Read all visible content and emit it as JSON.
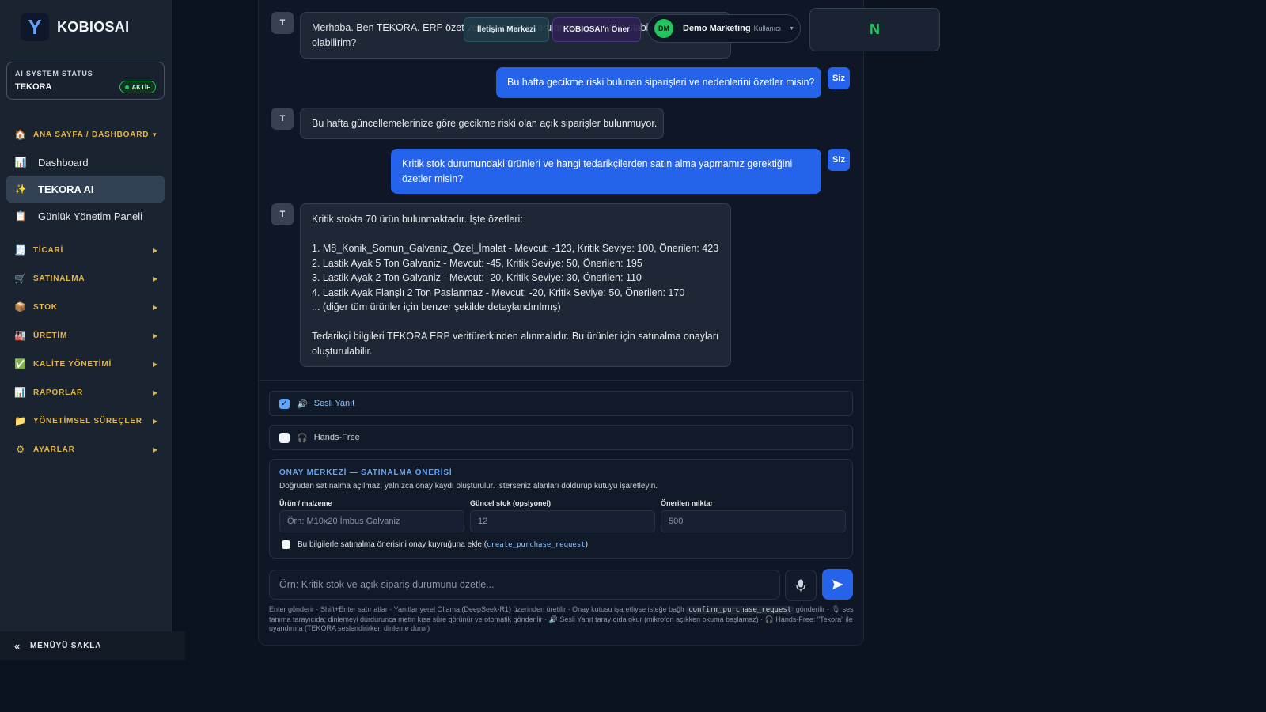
{
  "brand": {
    "logo": "Y",
    "name": "KOBIOSAI"
  },
  "status": {
    "label": "AI SYSTEM STATUS",
    "name": "TEKORA",
    "badge": "AKTİF"
  },
  "nav": {
    "home_section": "ANA SAYFA / DASHBOARD",
    "items": [
      {
        "label": "Dashboard",
        "icon": "chart-icon"
      },
      {
        "label": "TEKORA AI",
        "icon": "sparkle-icon"
      },
      {
        "label": "Günlük Yönetim Paneli",
        "icon": "clipboard-icon"
      }
    ],
    "sections": [
      {
        "label": "TİCARİ",
        "icon": "register-icon"
      },
      {
        "label": "SATINALMA",
        "icon": "cart-icon"
      },
      {
        "label": "STOK",
        "icon": "box-icon"
      },
      {
        "label": "ÜRETİM",
        "icon": "factory-icon"
      },
      {
        "label": "KALİTE YÖNETİMİ",
        "icon": "check-icon"
      },
      {
        "label": "RAPORLAR",
        "icon": "chart-icon"
      },
      {
        "label": "YÖNETİMSEL SÜREÇLER",
        "icon": "folder-icon"
      },
      {
        "label": "AYARLAR",
        "icon": "gear-icon"
      }
    ],
    "collapse_label": "MENÜYÜ SAKLA"
  },
  "header": {
    "btn_comm": "İletişim Merkezi",
    "btn_suggest": "KOBIOSAI'n Öner",
    "user": {
      "initials": "DM",
      "name": "Demo Marketing",
      "role": "Kullanıcı"
    },
    "notif": "N"
  },
  "chat": {
    "bot_avatar": "T",
    "user_badge": "Siz",
    "messages": [
      {
        "role": "bot",
        "lines": [
          "Merhaba. Ben TEKORA. ERP özet verilerine göre sorularınıza yardımcı olabilirim. Nasıl yardımcı",
          "olabilirim?"
        ]
      },
      {
        "role": "user",
        "lines": [
          "Bu hafta gecikme riski bulunan siparişleri ve nedenlerini özetler misin?"
        ]
      },
      {
        "role": "bot",
        "lines": [
          "Bu hafta güncellemelerinize göre gecikme riski olan açık siparişler bulunmuyor."
        ]
      },
      {
        "role": "user",
        "lines": [
          "Kritik stok durumundaki ürünleri ve hangi tedarikçilerden satın alma yapmamız gerektiğini",
          "özetler misin?"
        ]
      },
      {
        "role": "bot",
        "lines": [
          "Kritik stokta 70 ürün bulunmaktadır. İşte özetleri:",
          "",
          "1. M8_Konik_Somun_Galvaniz_Özel_İmalat - Mevcut: -123, Kritik Seviye: 100, Önerilen: 423",
          "2. Lastik Ayak 5 Ton Galvaniz - Mevcut: -45, Kritik Seviye: 50, Önerilen: 195",
          "3. Lastik Ayak 2 Ton Galvaniz - Mevcut: -20, Kritik Seviye: 30, Önerilen: 110",
          "4. Lastik Ayak Flanşlı 2 Ton Paslanmaz - Mevcut: -20, Kritik Seviye: 50, Önerilen: 170",
          "... (diğer tüm ürünler için benzer şekilde detaylandırılmış)",
          "",
          "Tedarikçi bilgileri TEKORA ERP veritürerkinden alınmalıdır. Bu ürünler için satınalma onayları",
          "oluşturulabilir."
        ]
      }
    ]
  },
  "options": {
    "voice": {
      "label": "Sesli Yanıt",
      "checked": true,
      "icon": "speaker-icon"
    },
    "handsfree": {
      "label": "Hands-Free",
      "checked": false,
      "icon": "headphones-icon"
    }
  },
  "approval": {
    "title": "ONAY MERKEZİ — SATINALMA ÖNERİSİ",
    "desc": "Doğrudan satınalma açılmaz; yalnızca onay kaydı oluşturulur. İsterseniz alanları doldurup kutuyu işaretleyin.",
    "fields": [
      {
        "label": "Ürün / malzeme",
        "placeholder": "Örn: M10x20 İmbus Galvaniz"
      },
      {
        "label": "Güncel stok (opsiyonel)",
        "placeholder": "12"
      },
      {
        "label": "Önerilen miktar",
        "placeholder": "500"
      }
    ],
    "check_text": "Bu bilgilerle satınalma önerisini onay kuyruğuna ekle (",
    "check_code": "create_purchase_request",
    "check_close": ")"
  },
  "composer": {
    "placeholder": "Örn: Kritik stok ve açık sipariş durumunu özetle...",
    "mic_icon": "mic-icon",
    "send_icon": "send-icon"
  },
  "hint": {
    "part1": "Enter gönderir · Shift+Enter satır atlar · Yanıtlar yerel Ollama (DeepSeek-R1) üzerinden üretilir · Onay kutusu işaretliyse isteğe bağlı",
    "code": "confirm_purchase_request",
    "part2": "gönderilir · 🎙 ses tanıma tarayıcıda; dinlemeyi durdurunca metin kısa süre görünür ve otomatik gönderilir · 🔊 Sesli Yanıt tarayıcıda okur (mikrofon açıkken okuma başlamaz) · 🎧 Hands-Free: \"Tekora\" ile uyandırma (TEKORA seslendirirken dinleme durur)"
  }
}
